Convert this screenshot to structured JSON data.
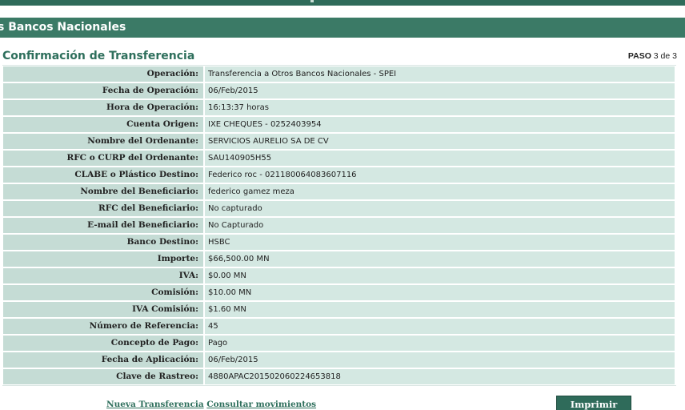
{
  "section": {
    "title": "Otros Bancos Nacionales",
    "visible_text": "s Bancos Nacionales"
  },
  "page": {
    "title": "Confirmación de Transferencia",
    "step_label": "PASO",
    "step_value": "3 de 3"
  },
  "details": [
    {
      "label": "Operación:",
      "value": "Transferencia a Otros Bancos Nacionales - SPEI"
    },
    {
      "label": "Fecha de Operación:",
      "value": "06/Feb/2015"
    },
    {
      "label": "Hora de Operación:",
      "value": "16:13:37 horas"
    },
    {
      "label": "Cuenta Origen:",
      "value": "IXE CHEQUES - 0252403954"
    },
    {
      "label": "Nombre del Ordenante:",
      "value": "SERVICIOS AURELIO SA DE CV"
    },
    {
      "label": "RFC o CURP del Ordenante:",
      "value": "SAU140905H55"
    },
    {
      "label": "CLABE o Plástico Destino:",
      "value": "Federico roc - 021180064083607116"
    },
    {
      "label": "Nombre del Beneficiario:",
      "value": "federico gamez meza"
    },
    {
      "label": "RFC del Beneficiario:",
      "value": "No capturado"
    },
    {
      "label": "E-mail del Beneficiario:",
      "value": "No Capturado"
    },
    {
      "label": "Banco Destino:",
      "value": "HSBC"
    },
    {
      "label": "Importe:",
      "value": "$66,500.00 MN"
    },
    {
      "label": "IVA:",
      "value": "$0.00 MN"
    },
    {
      "label": "Comisión:",
      "value": "$10.00 MN"
    },
    {
      "label": "IVA Comisión:",
      "value": "$1.60 MN"
    },
    {
      "label": "Número de Referencia:",
      "value": "45"
    },
    {
      "label": "Concepto de Pago:",
      "value": "Pago"
    },
    {
      "label": "Fecha de Aplicación:",
      "value": "06/Feb/2015"
    },
    {
      "label": "Clave de Rastreo:",
      "value": "4880APAC201502060224653818"
    }
  ],
  "actions": {
    "new_transfer": "Nueva Transferencia",
    "view_movements": "Consultar movimientos",
    "print": "Imprimir"
  },
  "colors": {
    "header_bar": "#3b7a66",
    "title_text": "#2e6f5c",
    "label_cell": "#c5dcd5",
    "value_cell": "#d4e8e2",
    "button": "#2f6b5a"
  }
}
